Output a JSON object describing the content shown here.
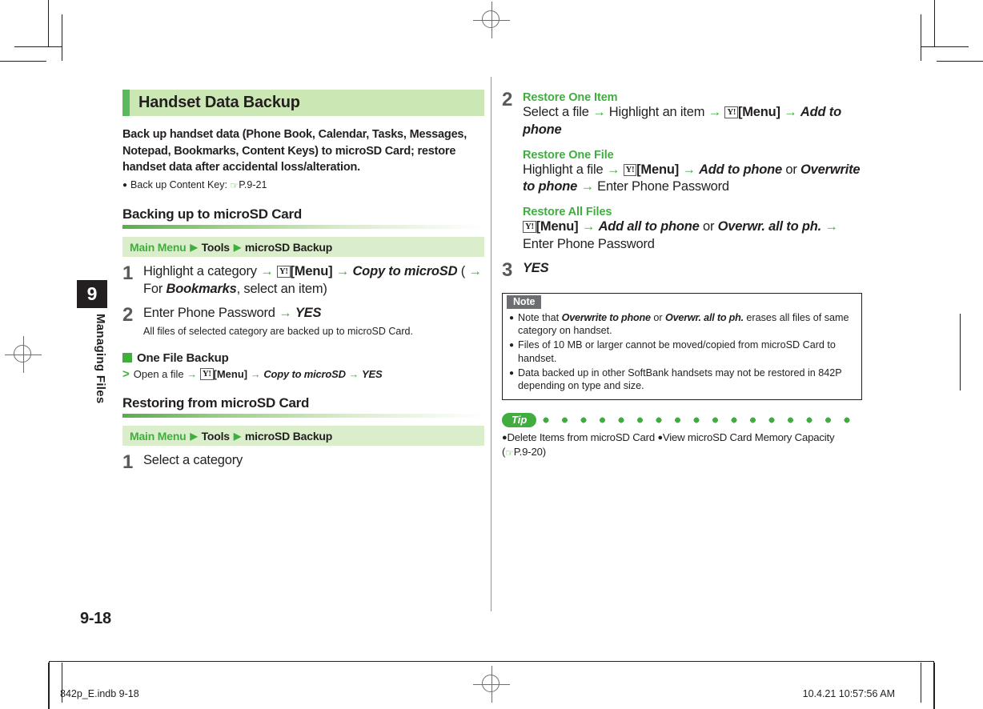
{
  "document": {
    "chapter_number": "9",
    "chapter_title": "Managing Files",
    "folio": "9-18",
    "slug_left": "842p_E.indb   9-18",
    "slug_right": "10.4.21   10:57:56 AM"
  },
  "colors": {
    "accent_green": "#3fae3f",
    "header_bar_bg": "#cbe7b4",
    "header_bar_accent": "#5cb85c",
    "path_bar_bg": "#dbeecb",
    "note_caption_bg": "#6d6e71",
    "tab_bg": "#231f20"
  },
  "left_column": {
    "chapter_heading": "Handset Data Backup",
    "intro": "Back up handset data (Phone Book, Calendar, Tasks, Messages, Notepad, Bookmarks, Content Keys) to microSD Card; restore handset data after accidental loss/alteration.",
    "intro_bullet": {
      "text": "Back up Content Key:",
      "page_ref": "P.9-21"
    },
    "section1": {
      "heading": "Backing up to microSD Card",
      "path": {
        "main_menu": "Main Menu",
        "item1": "Tools",
        "item2": "microSD Backup"
      },
      "steps": [
        {
          "number": "1",
          "parts": [
            {
              "t": "plain",
              "v": "Highlight a category "
            },
            {
              "t": "arrow",
              "v": "→"
            },
            {
              "t": "ykey",
              "v": "Y!"
            },
            {
              "t": "bold",
              "v": "[Menu]"
            },
            {
              "t": "arrow",
              "v": "→"
            },
            {
              "t": "bolditalic",
              "v": "Copy to microSD"
            },
            {
              "t": "plain",
              "v": " ("
            },
            {
              "t": "arrow",
              "v": "→"
            },
            {
              "t": "plain",
              "v": " For "
            },
            {
              "t": "bolditalic",
              "v": "Bookmarks"
            },
            {
              "t": "plain",
              "v": ", select an item)"
            }
          ],
          "sub": ""
        },
        {
          "number": "2",
          "parts": [
            {
              "t": "plain",
              "v": "Enter Phone Password "
            },
            {
              "t": "arrow",
              "v": "→"
            },
            {
              "t": "bolditalic",
              "v": "YES"
            }
          ],
          "sub": "All files of selected category are backed up to microSD Card."
        }
      ],
      "subsection": {
        "title": "One File Backup",
        "marker": ">",
        "line": [
          {
            "t": "plain",
            "v": "Open a file "
          },
          {
            "t": "arrow",
            "v": "→"
          },
          {
            "t": "ykey",
            "v": "Y!"
          },
          {
            "t": "bold",
            "v": "[Menu]"
          },
          {
            "t": "arrow",
            "v": "→"
          },
          {
            "t": "bolditalic",
            "v": "Copy to microSD"
          },
          {
            "t": "arrow",
            "v": "→"
          },
          {
            "t": "bolditalic",
            "v": "YES"
          }
        ]
      }
    },
    "section2": {
      "heading": "Restoring from microSD Card",
      "path": {
        "main_menu": "Main Menu",
        "item1": "Tools",
        "item2": "microSD Backup"
      },
      "steps": [
        {
          "number": "1",
          "parts": [
            {
              "t": "plain",
              "v": "Select a category"
            }
          ],
          "sub": ""
        }
      ]
    }
  },
  "right_column": {
    "step2": {
      "number": "2",
      "block1": {
        "heading": "Restore One Item",
        "parts": [
          {
            "t": "plain",
            "v": "Select a file "
          },
          {
            "t": "arrow",
            "v": "→"
          },
          {
            "t": "plain",
            "v": " Highlight an item "
          },
          {
            "t": "arrow",
            "v": "→"
          },
          {
            "t": "ykey",
            "v": "Y!"
          },
          {
            "t": "bold",
            "v": "[Menu]"
          },
          {
            "t": "arrow",
            "v": "→"
          },
          {
            "t": "bolditalic",
            "v": "Add to phone"
          }
        ]
      },
      "block2": {
        "heading": "Restore One File",
        "parts": [
          {
            "t": "plain",
            "v": "Highlight a file "
          },
          {
            "t": "arrow",
            "v": "→"
          },
          {
            "t": "ykey",
            "v": "Y!"
          },
          {
            "t": "bold",
            "v": "[Menu]"
          },
          {
            "t": "arrow",
            "v": "→"
          },
          {
            "t": "bolditalic",
            "v": "Add to phone"
          },
          {
            "t": "plain",
            "v": " or "
          },
          {
            "t": "bolditalic",
            "v": "Overwrite to phone"
          },
          {
            "t": "arrow",
            "v": "→"
          },
          {
            "t": "plain",
            "v": " Enter Phone Password"
          }
        ]
      },
      "block3": {
        "heading": "Restore All Files",
        "parts": [
          {
            "t": "ykey",
            "v": "Y!"
          },
          {
            "t": "bold",
            "v": "[Menu]"
          },
          {
            "t": "arrow",
            "v": "→"
          },
          {
            "t": "bolditalic",
            "v": "Add all to phone"
          },
          {
            "t": "plain",
            "v": " or "
          },
          {
            "t": "bolditalic",
            "v": "Overwr. all to ph."
          },
          {
            "t": "arrow",
            "v": "→"
          },
          {
            "t": "plain",
            "v": " Enter Phone Password"
          }
        ]
      }
    },
    "step3": {
      "number": "3",
      "parts": [
        {
          "t": "bolditalic",
          "v": "YES"
        }
      ]
    },
    "note": {
      "caption": "Note",
      "items": [
        [
          {
            "t": "plain",
            "v": "Note that "
          },
          {
            "t": "bolditalic",
            "v": "Overwrite to phone"
          },
          {
            "t": "plain",
            "v": " or "
          },
          {
            "t": "bolditalic",
            "v": "Overwr. all to ph."
          },
          {
            "t": "plain",
            "v": " erases all files of same category on handset."
          }
        ],
        [
          {
            "t": "plain",
            "v": "Files of 10 MB or larger cannot be moved/copied from microSD Card to handset."
          }
        ],
        [
          {
            "t": "plain",
            "v": "Data backed up in other SoftBank handsets may not be restored in 842P depending on type and size."
          }
        ]
      ]
    },
    "tip": {
      "label": "Tip",
      "items": [
        "Delete Items from microSD Card",
        "View microSD Card Memory Capacity"
      ],
      "page_ref": "P.9-20"
    }
  }
}
